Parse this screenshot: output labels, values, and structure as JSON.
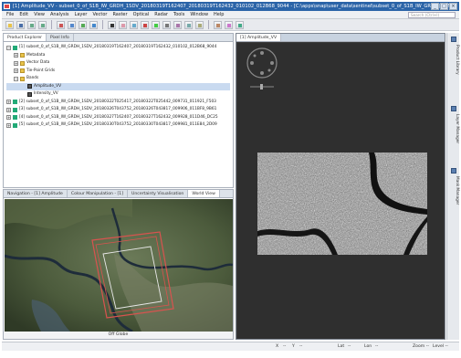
{
  "window": {
    "title": "[1] Amplitude_VV - subset_0_of_S1B_IW_GRDH_1SDV_20180319T162407_20180319T162432_010102_012B68_9044 - [C:\\apps\\snap\\user_data\\sentinel\\subset_0_of_S1B_IW_GRDH] - SNAP"
  },
  "menu": {
    "items": [
      "File",
      "Edit",
      "View",
      "Analysis",
      "Layer",
      "Vector",
      "Raster",
      "Optical",
      "Radar",
      "Tools",
      "Window",
      "Help"
    ],
    "search_placeholder": "Search (Ctrl+I)"
  },
  "product_explorer": {
    "tabs": [
      "Product Explorer",
      "Pixel Info"
    ],
    "products": [
      {
        "label": "[1] subset_0_of_S1B_IW_GRDH_1SDV_20180319T162407_20180319T162432_010102_012B68_9044",
        "expanded": true
      },
      {
        "label": "Metadata",
        "indent": 1,
        "type": "folder"
      },
      {
        "label": "Vector Data",
        "indent": 1,
        "type": "folder"
      },
      {
        "label": "Tie-Point Grids",
        "indent": 1,
        "type": "folder"
      },
      {
        "label": "Bands",
        "indent": 1,
        "type": "folder",
        "expanded": true
      },
      {
        "label": "Amplitude_VV",
        "indent": 2,
        "type": "band",
        "selected": true
      },
      {
        "label": "Intensity_VV",
        "indent": 2,
        "type": "band"
      },
      {
        "label": "[2] subset_0_of_S1B_IW_GRDH_1SDV_20180322T025417_20180322T025442_009731_011921_F503"
      },
      {
        "label": "[3] subset_0_of_S1B_IW_GRDH_1SDV_20180326T043752_20180326T043817_009906_011BF8_9B61"
      },
      {
        "label": "[4] subset_0_of_S1B_IW_GRDH_1SDV_20180327T162407_20180327T162432_009928_011D46_DC25"
      },
      {
        "label": "[5] subset_0_of_S1B_IW_GRDH_1SDV_20180330T043752_20180330T043817_009981_011E84_2D09"
      }
    ]
  },
  "bottom_panel": {
    "tabs": [
      "Navigation - [1] Amplitude",
      "Colour Manipulation - [1]",
      "Uncertainty Visualisation",
      "World View"
    ],
    "footer": "Off Globe"
  },
  "image_view": {
    "tab": "[1] Amplitude_VV"
  },
  "right_sidebar": {
    "tabs": [
      "Product Library",
      "Layer Manager",
      "Mask Manager"
    ]
  },
  "status": {
    "x_label": "X",
    "x_value": "--",
    "y_label": "Y",
    "y_value": "--",
    "lat_label": "Lat",
    "lat_value": "--",
    "lon_label": "Lon",
    "lon_value": "--",
    "zoom_label": "Zoom --",
    "level_label": "Level --"
  },
  "colors": {
    "titlebar": "#2b64a8",
    "viewport": "#2f2f2f",
    "footprint_red": "#d9534f",
    "footprint_white": "#e8e8e8"
  }
}
